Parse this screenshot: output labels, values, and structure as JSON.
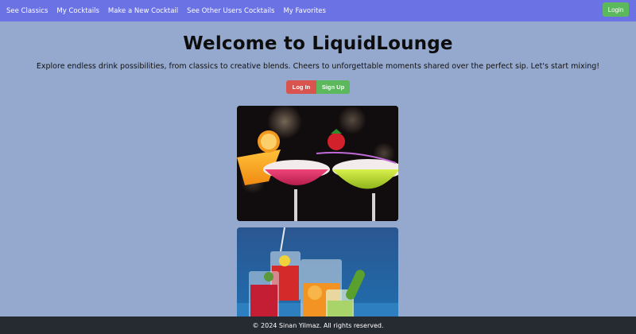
{
  "nav": {
    "links": [
      "See Classics",
      "My Cocktails",
      "Make a New Cocktail",
      "See Other Users Cocktails",
      "My Favorites"
    ],
    "login_label": "Login",
    "bg_color": "#6b72e4"
  },
  "hero": {
    "title": "Welcome to LiquidLounge",
    "subtitle": "Explore endless drink possibilities, from classics to creative blends. Cheers to unforgettable moments shared over the perfect sip. Let's start mixing!"
  },
  "auth": {
    "login_label": "Log In",
    "signup_label": "Sign Up",
    "login_color": "#d9534f",
    "signup_color": "#5cb85c"
  },
  "gallery": {
    "images": [
      "margaritas-photo",
      "mixed-cocktails-photo"
    ]
  },
  "footer": {
    "text": "© 2024 Sinan Yilmaz. All rights reserved."
  },
  "colors": {
    "page_bg": "#95a9cf",
    "footer_bg": "#262b31"
  }
}
